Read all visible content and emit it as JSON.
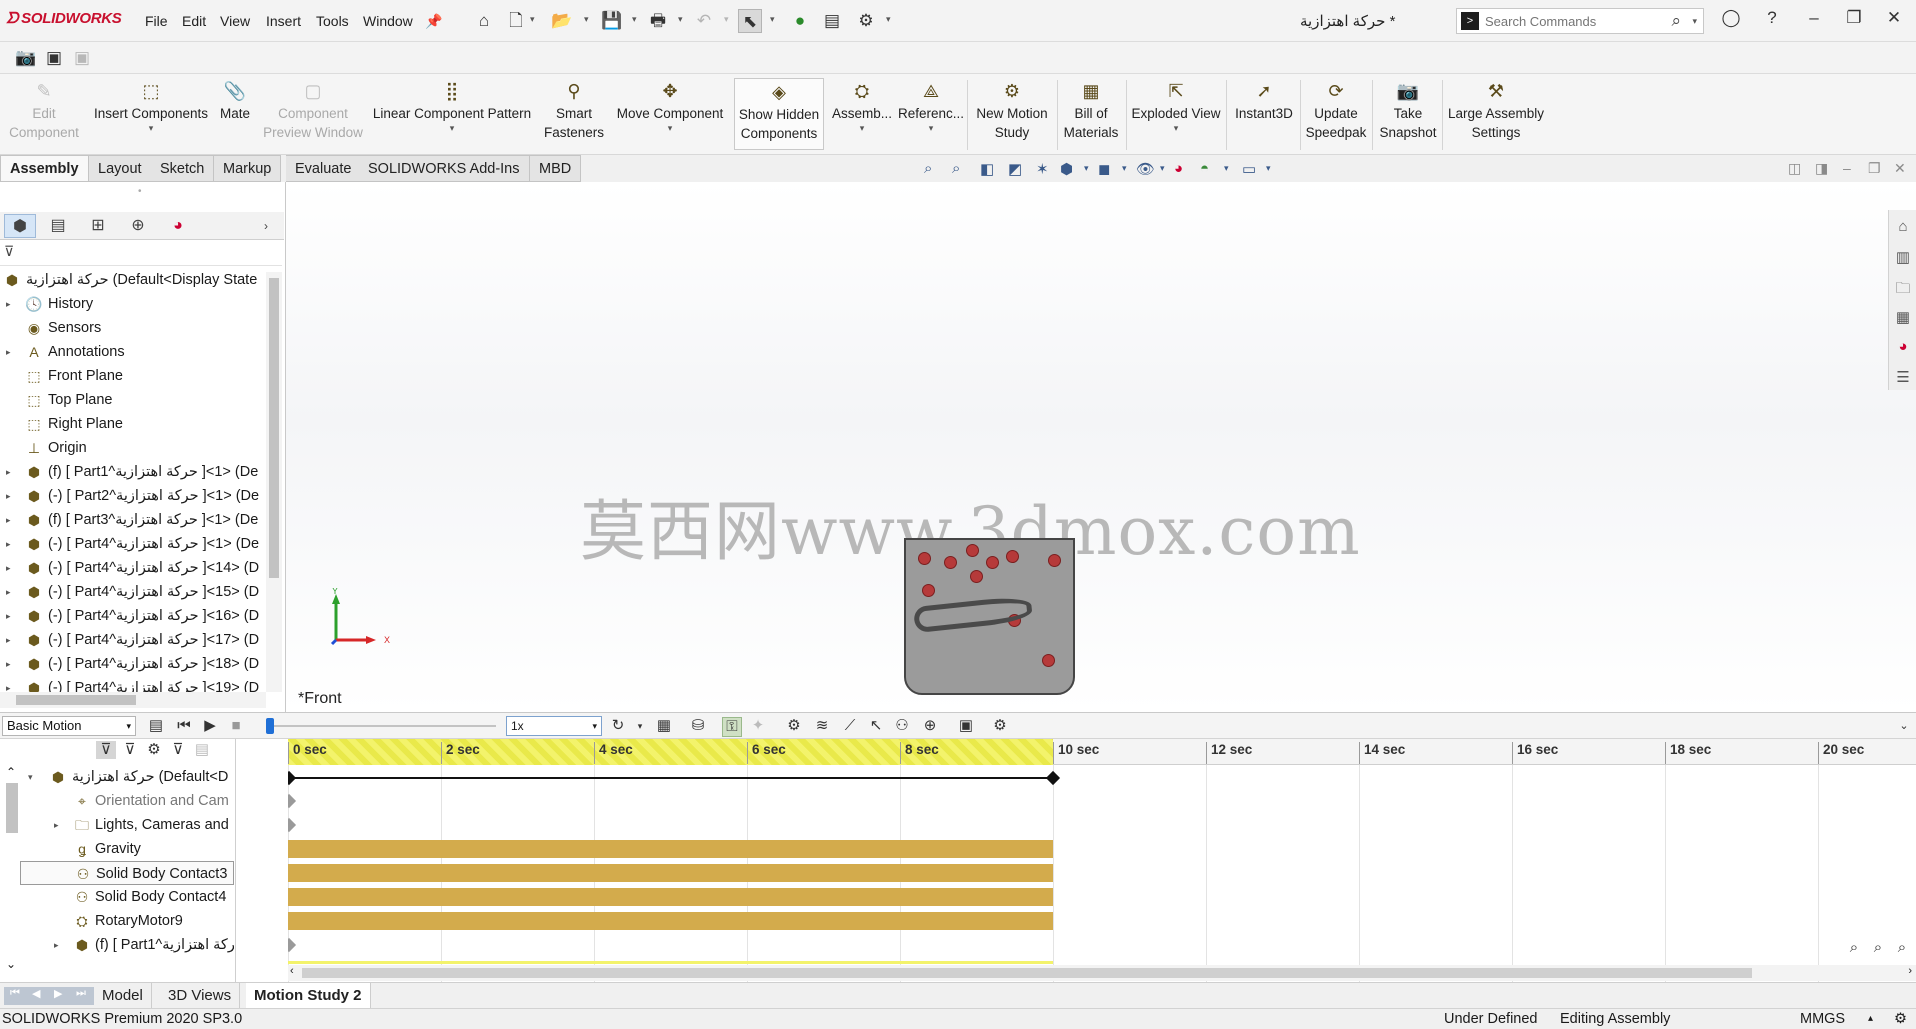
{
  "app": {
    "logo": "SOLIDWORKS",
    "document_title": "حركة اهتزازية *"
  },
  "menu": [
    "File",
    "Edit",
    "View",
    "Insert",
    "Tools",
    "Window"
  ],
  "search": {
    "placeholder": "Search Commands"
  },
  "ribbon": [
    {
      "label_lines": [
        "Edit",
        "Component"
      ],
      "state": "disabled"
    },
    {
      "label_lines": [
        "Insert Components"
      ],
      "state": "normal"
    },
    {
      "label_lines": [
        "Mate"
      ],
      "state": "normal"
    },
    {
      "label_lines": [
        "Component",
        "Preview Window"
      ],
      "state": "disabled"
    },
    {
      "label_lines": [
        "Linear Component Pattern"
      ],
      "state": "normal"
    },
    {
      "label_lines": [
        "Smart",
        "Fasteners"
      ],
      "state": "normal"
    },
    {
      "label_lines": [
        "Move Component"
      ],
      "state": "normal"
    },
    {
      "label_lines": [
        "Show Hidden",
        "Components"
      ],
      "state": "active"
    },
    {
      "label_lines": [
        "Assemb..."
      ],
      "state": "normal"
    },
    {
      "label_lines": [
        "Referenc..."
      ],
      "state": "normal"
    },
    {
      "label_lines": [
        "New Motion",
        "Study"
      ],
      "state": "normal"
    },
    {
      "label_lines": [
        "Bill of",
        "Materials"
      ],
      "state": "normal"
    },
    {
      "label_lines": [
        "Exploded View"
      ],
      "state": "normal"
    },
    {
      "label_lines": [
        "Instant3D"
      ],
      "state": "normal"
    },
    {
      "label_lines": [
        "Update",
        "Speedpak"
      ],
      "state": "normal"
    },
    {
      "label_lines": [
        "Take",
        "Snapshot"
      ],
      "state": "normal"
    },
    {
      "label_lines": [
        "Large Assembly",
        "Settings"
      ],
      "state": "normal"
    }
  ],
  "tabs": [
    {
      "label": "Assembly",
      "active": true
    },
    {
      "label": "Layout"
    },
    {
      "label": "Sketch"
    },
    {
      "label": "Markup"
    },
    {
      "label": "Evaluate"
    },
    {
      "label": "SOLIDWORKS Add-Ins"
    },
    {
      "label": "MBD"
    }
  ],
  "feature_tree": {
    "root": "حركة اهتزازية  (Default<Display State",
    "items": [
      {
        "label": "History",
        "icon": "history-icon",
        "expandable": true
      },
      {
        "label": "Sensors",
        "icon": "sensor-icon",
        "expandable": false
      },
      {
        "label": "Annotations",
        "icon": "annotation-icon",
        "expandable": true
      },
      {
        "label": "Front Plane",
        "icon": "plane-icon",
        "expandable": false
      },
      {
        "label": "Top Plane",
        "icon": "plane-icon",
        "expandable": false
      },
      {
        "label": "Right Plane",
        "icon": "plane-icon",
        "expandable": false
      },
      {
        "label": "Origin",
        "icon": "origin-icon",
        "expandable": false
      },
      {
        "label": "(f) [ Part1^حركة اهتزازية ]<1> (De",
        "icon": "part-icon",
        "expandable": true
      },
      {
        "label": "(-) [ Part2^حركة اهتزازية ]<1> (De",
        "icon": "part-icon",
        "expandable": true
      },
      {
        "label": "(f) [ Part3^حركة اهتزازية ]<1> (De",
        "icon": "part-icon",
        "expandable": true
      },
      {
        "label": "(-) [ Part4^حركة اهتزازية ]<1> (De",
        "icon": "part-icon",
        "expandable": true
      },
      {
        "label": "(-) [ Part4^حركة اهتزازية ]<14> (D",
        "icon": "part-icon",
        "expandable": true
      },
      {
        "label": "(-) [ Part4^حركة اهتزازية ]<15> (D",
        "icon": "part-icon",
        "expandable": true
      },
      {
        "label": "(-) [ Part4^حركة اهتزازية ]<16> (D",
        "icon": "part-icon",
        "expandable": true
      },
      {
        "label": "(-) [ Part4^حركة اهتزازية ]<17> (D",
        "icon": "part-icon",
        "expandable": true
      },
      {
        "label": "(-) [ Part4^حركة اهتزازية ]<18> (D",
        "icon": "part-icon",
        "expandable": true
      },
      {
        "label": "(-) [ Part4^حركة اهتزازية ]<19> (D",
        "icon": "part-icon",
        "expandable": true
      }
    ]
  },
  "viewport": {
    "watermark": "莫西网www.3dmox.com",
    "view_label": "*Front",
    "triad": {
      "y": "Y",
      "x": "X"
    }
  },
  "motion": {
    "study_type": "Basic Motion",
    "playback_speed": "1x",
    "tree_root": "حركة اهتزازية  (Default<D",
    "items": [
      {
        "label": "Orientation and Cam",
        "icon": "camera-icon",
        "grey": true,
        "expandable": false,
        "bar": false
      },
      {
        "label": "Lights, Cameras and",
        "icon": "lights-folder-icon",
        "expandable": true,
        "bar": false
      },
      {
        "label": "Gravity",
        "icon": "gravity-icon",
        "expandable": false,
        "bar": true
      },
      {
        "label": "Solid Body Contact3",
        "icon": "contact-icon",
        "expandable": false,
        "bar": true,
        "boxed": true
      },
      {
        "label": "Solid Body Contact4",
        "icon": "contact-icon",
        "expandable": false,
        "bar": true
      },
      {
        "label": "RotaryMotor9",
        "icon": "motor-icon",
        "expandable": false,
        "bar": true
      },
      {
        "label": "(f) [ Part1^حركة اهتزازية",
        "icon": "part-icon",
        "expandable": true,
        "bar": false
      }
    ],
    "time_ticks": [
      "0 sec",
      "2 sec",
      "4 sec",
      "6 sec",
      "8 sec",
      "10 sec",
      "12 sec",
      "14 sec",
      "16 sec",
      "18 sec",
      "20 sec"
    ],
    "study_end_sec": 10,
    "tick_step_sec": 2
  },
  "bottom_tabs": [
    {
      "label": "Model"
    },
    {
      "label": "3D Views"
    },
    {
      "label": "Motion Study 2",
      "active": true
    }
  ],
  "status": {
    "version": "SOLIDWORKS Premium 2020 SP3.0",
    "definition": "Under Defined",
    "mode": "Editing Assembly",
    "units": "MMGS"
  },
  "colors": {
    "accent": "#1f6fd6",
    "timeline_bar": "#d3ab4c",
    "timeline_highlight": "#f3f36b",
    "ball": "#b63a3a",
    "model_fill": "#9b9b9b"
  }
}
